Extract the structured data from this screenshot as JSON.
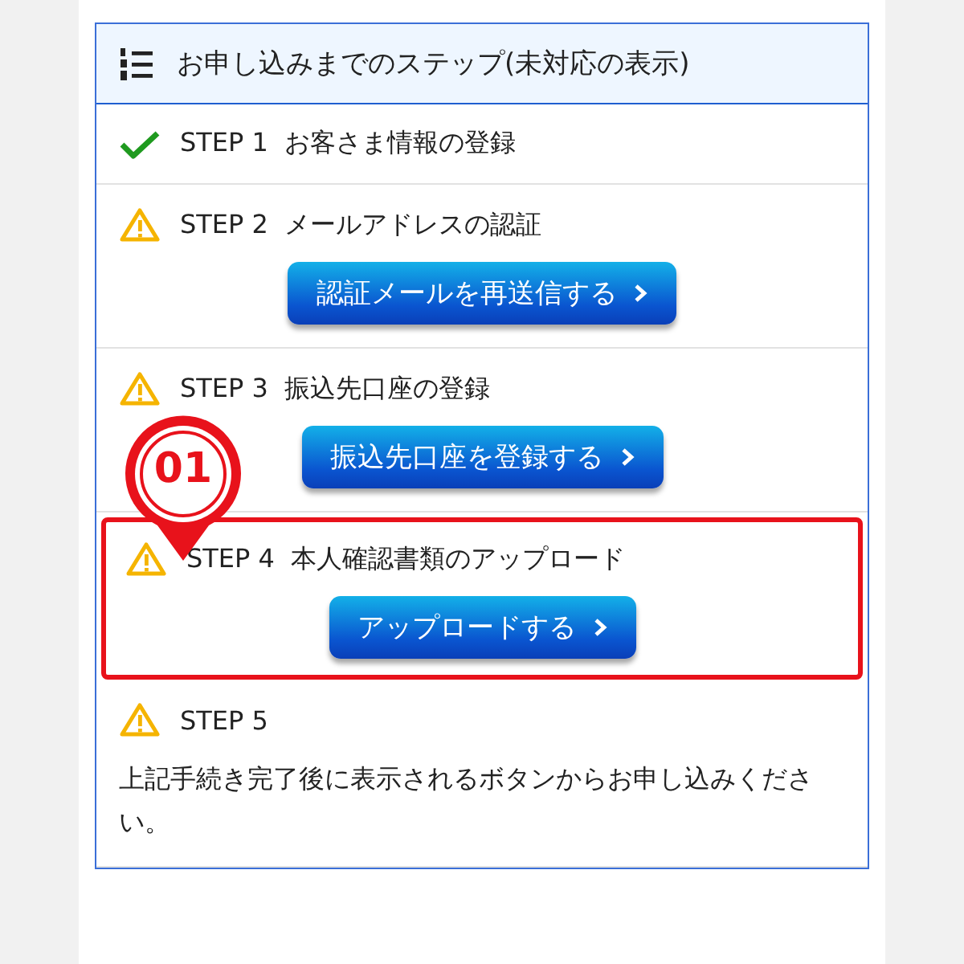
{
  "header": {
    "title": "お申し込みまでのステップ(未対応の表示)"
  },
  "marker": {
    "label": "01"
  },
  "steps": [
    {
      "kind": "done",
      "step": "STEP 1",
      "title": "お客さま情報の登録",
      "highlighted": false
    },
    {
      "kind": "warning",
      "step": "STEP 2",
      "title": "メールアドレスの認証",
      "button": "認証メールを再送信する",
      "highlighted": false
    },
    {
      "kind": "warning",
      "step": "STEP 3",
      "title": "振込先口座の登録",
      "button": "振込先口座を登録する",
      "highlighted": false
    },
    {
      "kind": "warning",
      "step": "STEP 4",
      "title": "本人確認書類のアップロード",
      "button": "アップロードする",
      "highlighted": true
    },
    {
      "kind": "warning",
      "step": "STEP 5",
      "note": "上記手続き完了後に表示されるボタンからお申し込みください。",
      "highlighted": false
    }
  ]
}
